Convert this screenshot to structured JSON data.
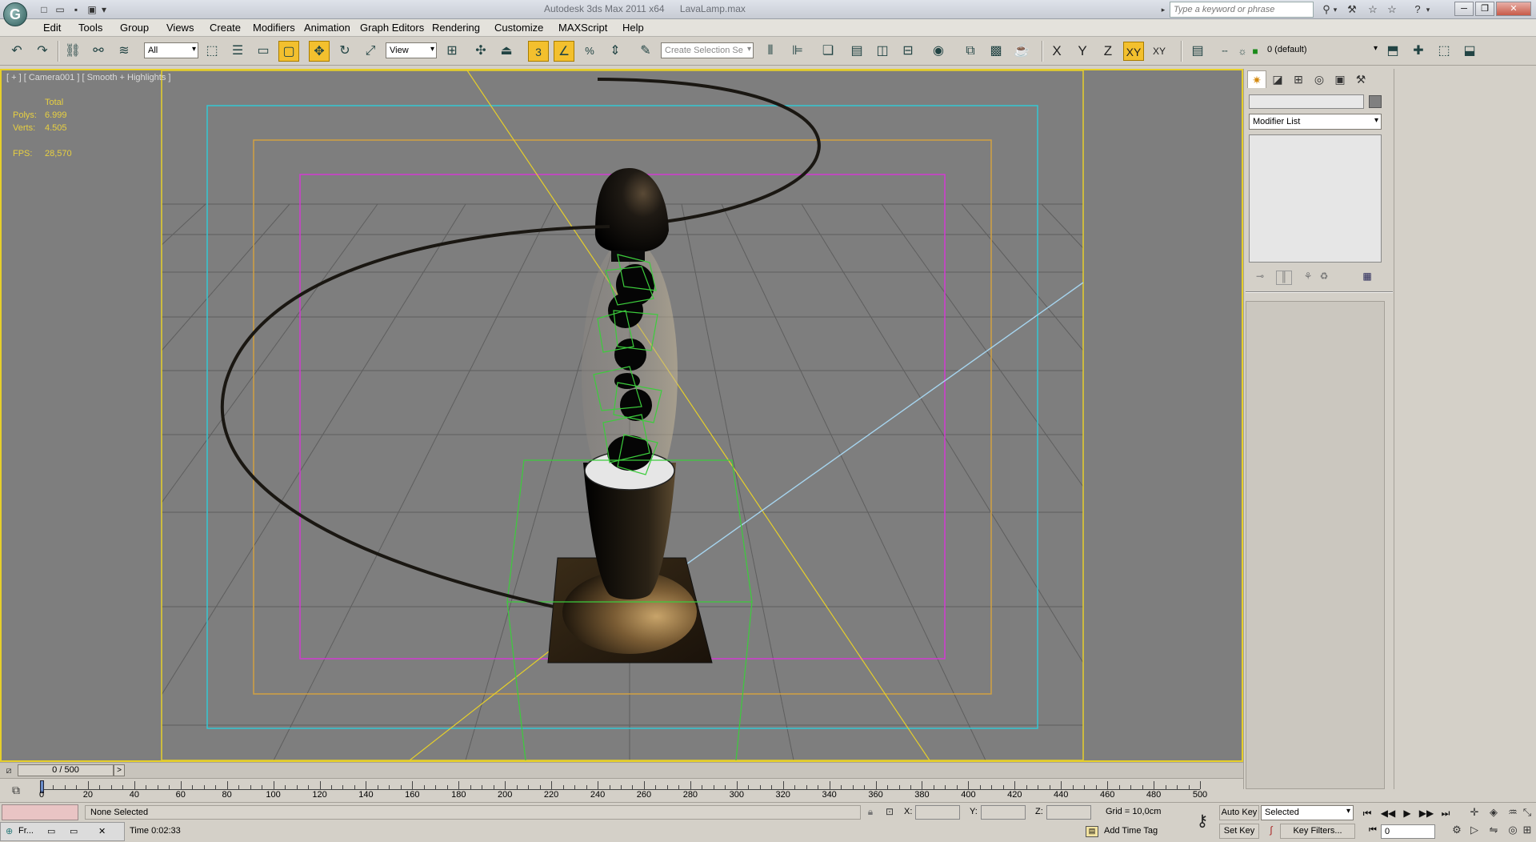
{
  "titlebar": {
    "app_name": "Autodesk 3ds Max  2011 x64",
    "file_name": "LavaLamp.max",
    "search_placeholder": "Type a keyword or phrase",
    "logo_letter": "G"
  },
  "menu": {
    "items": [
      "Edit",
      "Tools",
      "Group",
      "Views",
      "Create",
      "Modifiers",
      "Animation",
      "Graph Editors",
      "Rendering",
      "Customize",
      "MAXScript",
      "Help"
    ]
  },
  "toolbar": {
    "selection_filter": "All",
    "reference_coord": "View",
    "named_selection_placeholder": "Create Selection Se",
    "snap_label": "3",
    "axis": {
      "x": "X",
      "y": "Y",
      "z": "Z",
      "xy": "XY",
      "xy_lock": "XY"
    },
    "layer": "0 (default)"
  },
  "viewport": {
    "label": "[ + ] [ Camera001 ] [ Smooth + Highlights ]",
    "stats": {
      "header": "Total",
      "polys_label": "Polys:",
      "polys_value": "6.999",
      "verts_label": "Verts:",
      "verts_value": "4.505",
      "fps_label": "FPS:",
      "fps_value": "28,570"
    }
  },
  "command_panel": {
    "modifier_list": "Modifier List"
  },
  "timeline": {
    "slider_label": "0 / 500",
    "next_label": ">",
    "ticks": [
      "0",
      "20",
      "40",
      "60",
      "80",
      "100",
      "120",
      "140",
      "160",
      "180",
      "200",
      "220",
      "240",
      "260",
      "280",
      "300",
      "320",
      "340",
      "360",
      "380",
      "400",
      "420",
      "440",
      "460",
      "480",
      "500"
    ]
  },
  "statusbar": {
    "listener_label": "Fr...",
    "selection_text": "None Selected",
    "time_text": "Time  0:02:33",
    "x_label": "X:",
    "y_label": "Y:",
    "z_label": "Z:",
    "grid_text": "Grid = 10,0cm",
    "add_time_tag": "Add Time Tag",
    "auto_key": "Auto Key",
    "set_key": "Set Key",
    "key_mode": "Selected",
    "key_filters": "Key Filters...",
    "frame_value": "0"
  },
  "colors": {
    "viewport_bg": "#7e7e7e",
    "active_border": "#e6cf2a",
    "stats_text": "#e8d040",
    "safe_frame_cyan": "#33c7d4",
    "safe_frame_orange": "#d2a040",
    "safe_frame_magenta": "#d23ad2",
    "helper_green": "#3ccc3c",
    "light_blue_line": "#a6d4ee",
    "highlight_yellow": "#f3c02e"
  }
}
